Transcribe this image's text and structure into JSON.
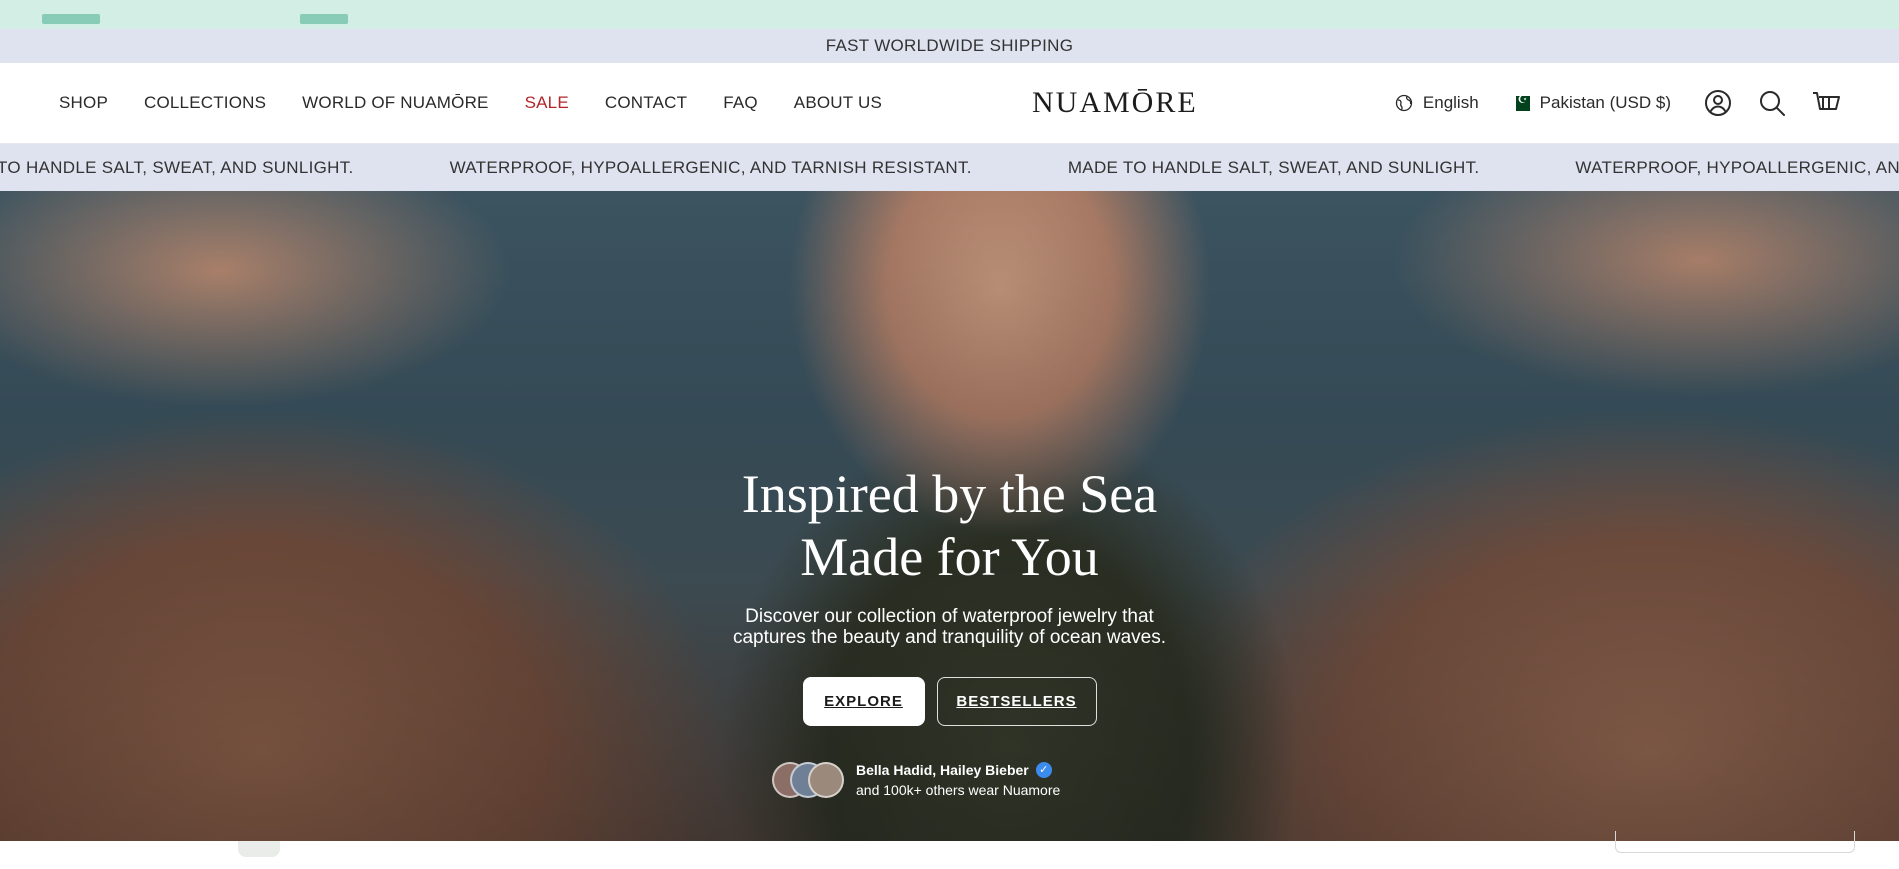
{
  "announcement": "FAST WORLDWIDE SHIPPING",
  "logo": "NUAMŌRE",
  "nav": {
    "items": [
      {
        "label": "SHOP"
      },
      {
        "label": "COLLECTIONS"
      },
      {
        "label": "WORLD OF NUAMŌRE"
      },
      {
        "label": "SALE"
      },
      {
        "label": "CONTACT"
      },
      {
        "label": "FAQ"
      },
      {
        "label": "ABOUT US"
      }
    ]
  },
  "header_tools": {
    "language": "English",
    "country": "Pakistan (USD $)",
    "icons": [
      "globe-icon",
      "pakistan-flag-icon",
      "account-icon",
      "search-icon",
      "cart-icon"
    ]
  },
  "ticker": {
    "items": [
      "MADE TO HANDLE SALT, SWEAT, AND SUNLIGHT.",
      "WATERPROOF, HYPOALLERGENIC, AND TARNISH RESISTANT.",
      "MADE TO HANDLE SALT, SWEAT, AND SUNLIGHT.",
      "WATERPROOF, HYPOALLERGENIC, AND TARNISH RESISTANT."
    ]
  },
  "hero": {
    "title_line1": "Inspired by the Sea",
    "title_line2": "Made for You",
    "subtitle_line1": "Discover our collection of waterproof jewelry that",
    "subtitle_line2": "captures the beauty and tranquility of ocean waves.",
    "primary_button": "EXPLORE",
    "secondary_button": "BESTSELLERS",
    "social_proof": {
      "names": "Bella Hadid, Hailey Bieber",
      "others": "and 100k+ others wear Nuamore"
    }
  },
  "colors": {
    "announcement_bg": "#dfe3f0",
    "top_strip_bg": "#d3efe5",
    "sale": "#b3262a",
    "verified": "#3c8cf0"
  }
}
